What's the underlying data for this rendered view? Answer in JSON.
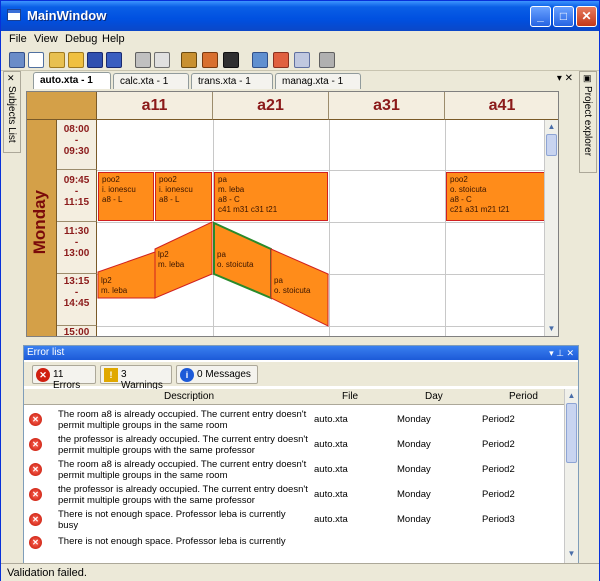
{
  "window": {
    "title": "MainWindow"
  },
  "menu": [
    "File",
    "View",
    "Debug",
    "Help"
  ],
  "left_dock": {
    "label": "Subjects List"
  },
  "right_dock": {
    "label": "Project explorer"
  },
  "tabs": [
    {
      "label": "auto.xta - 1",
      "active": true
    },
    {
      "label": "calc.xta - 1",
      "active": false
    },
    {
      "label": "trans.xta - 1",
      "active": false
    },
    {
      "label": "manag.xta - 1",
      "active": false
    }
  ],
  "tab_controls": "▾ ✕",
  "timetable": {
    "rooms": [
      "a11",
      "a21",
      "a31",
      "a41"
    ],
    "day": "Monday",
    "times": [
      {
        "start": "08:00",
        "sep": "-",
        "end": "09:30"
      },
      {
        "start": "09:45",
        "sep": "-",
        "end": "11:15"
      },
      {
        "start": "11:30",
        "sep": "-",
        "end": "13:00"
      },
      {
        "start": "13:15",
        "sep": "-",
        "end": "14:45"
      },
      {
        "start": "15:00",
        "sep": "",
        "end": ""
      }
    ],
    "activities": [
      {
        "lines": [
          "poo2",
          "i. ionescu",
          "a8 - L"
        ]
      },
      {
        "lines": [
          "poo2",
          "i. ionescu",
          "a8 - L"
        ]
      },
      {
        "lines": [
          "pa",
          "m. leba",
          "a8 - C",
          "c41 m31 c31 t21"
        ]
      },
      {
        "lines": [
          "poo2",
          "o. stoicuta",
          "a8 - C",
          "c21 a31 m21 t21"
        ]
      },
      {
        "lines": [
          "lp2",
          "m. leba"
        ]
      },
      {
        "lines": [
          "lp2",
          "m. leba"
        ]
      },
      {
        "lines": [
          "pa",
          "o. stoicuta"
        ]
      },
      {
        "lines": [
          "pa",
          "o. stoicuta"
        ]
      }
    ]
  },
  "error_panel": {
    "title": "Error list",
    "controls": "▾ ⊥ ✕",
    "filters": [
      {
        "label": "11 Errors",
        "icon": "error-icon",
        "color": "#d02010"
      },
      {
        "label": "3 Warnings",
        "icon": "warning-icon",
        "color": "#e0a800"
      },
      {
        "label": "0 Messages",
        "icon": "info-icon",
        "color": "#1c5ad8"
      }
    ],
    "columns": [
      "Description",
      "File",
      "Day",
      "Period"
    ],
    "rows": [
      {
        "description": "The room a8 is already occupied. The current entry doesn't permit multiple groups in the same room",
        "file": "auto.xta",
        "day": "Monday",
        "period": "Period2"
      },
      {
        "description": "the professor is already occupied. The current entry doesn't permit multiple groups with the same professor",
        "file": "auto.xta",
        "day": "Monday",
        "period": "Period2"
      },
      {
        "description": "The room a8 is already occupied. The current entry doesn't permit multiple groups in the same room",
        "file": "auto.xta",
        "day": "Monday",
        "period": "Period2"
      },
      {
        "description": "the professor is already occupied. The current entry doesn't permit multiple groups with the same professor",
        "file": "auto.xta",
        "day": "Monday",
        "period": "Period2"
      },
      {
        "description": "There is not enough space. Professor leba is currently busy",
        "file": "auto.xta",
        "day": "Monday",
        "period": "Period3"
      },
      {
        "description": "There is not enough space. Professor leba is currently",
        "file": "",
        "day": "",
        "period": ""
      }
    ]
  },
  "status": {
    "text": "Validation failed."
  }
}
